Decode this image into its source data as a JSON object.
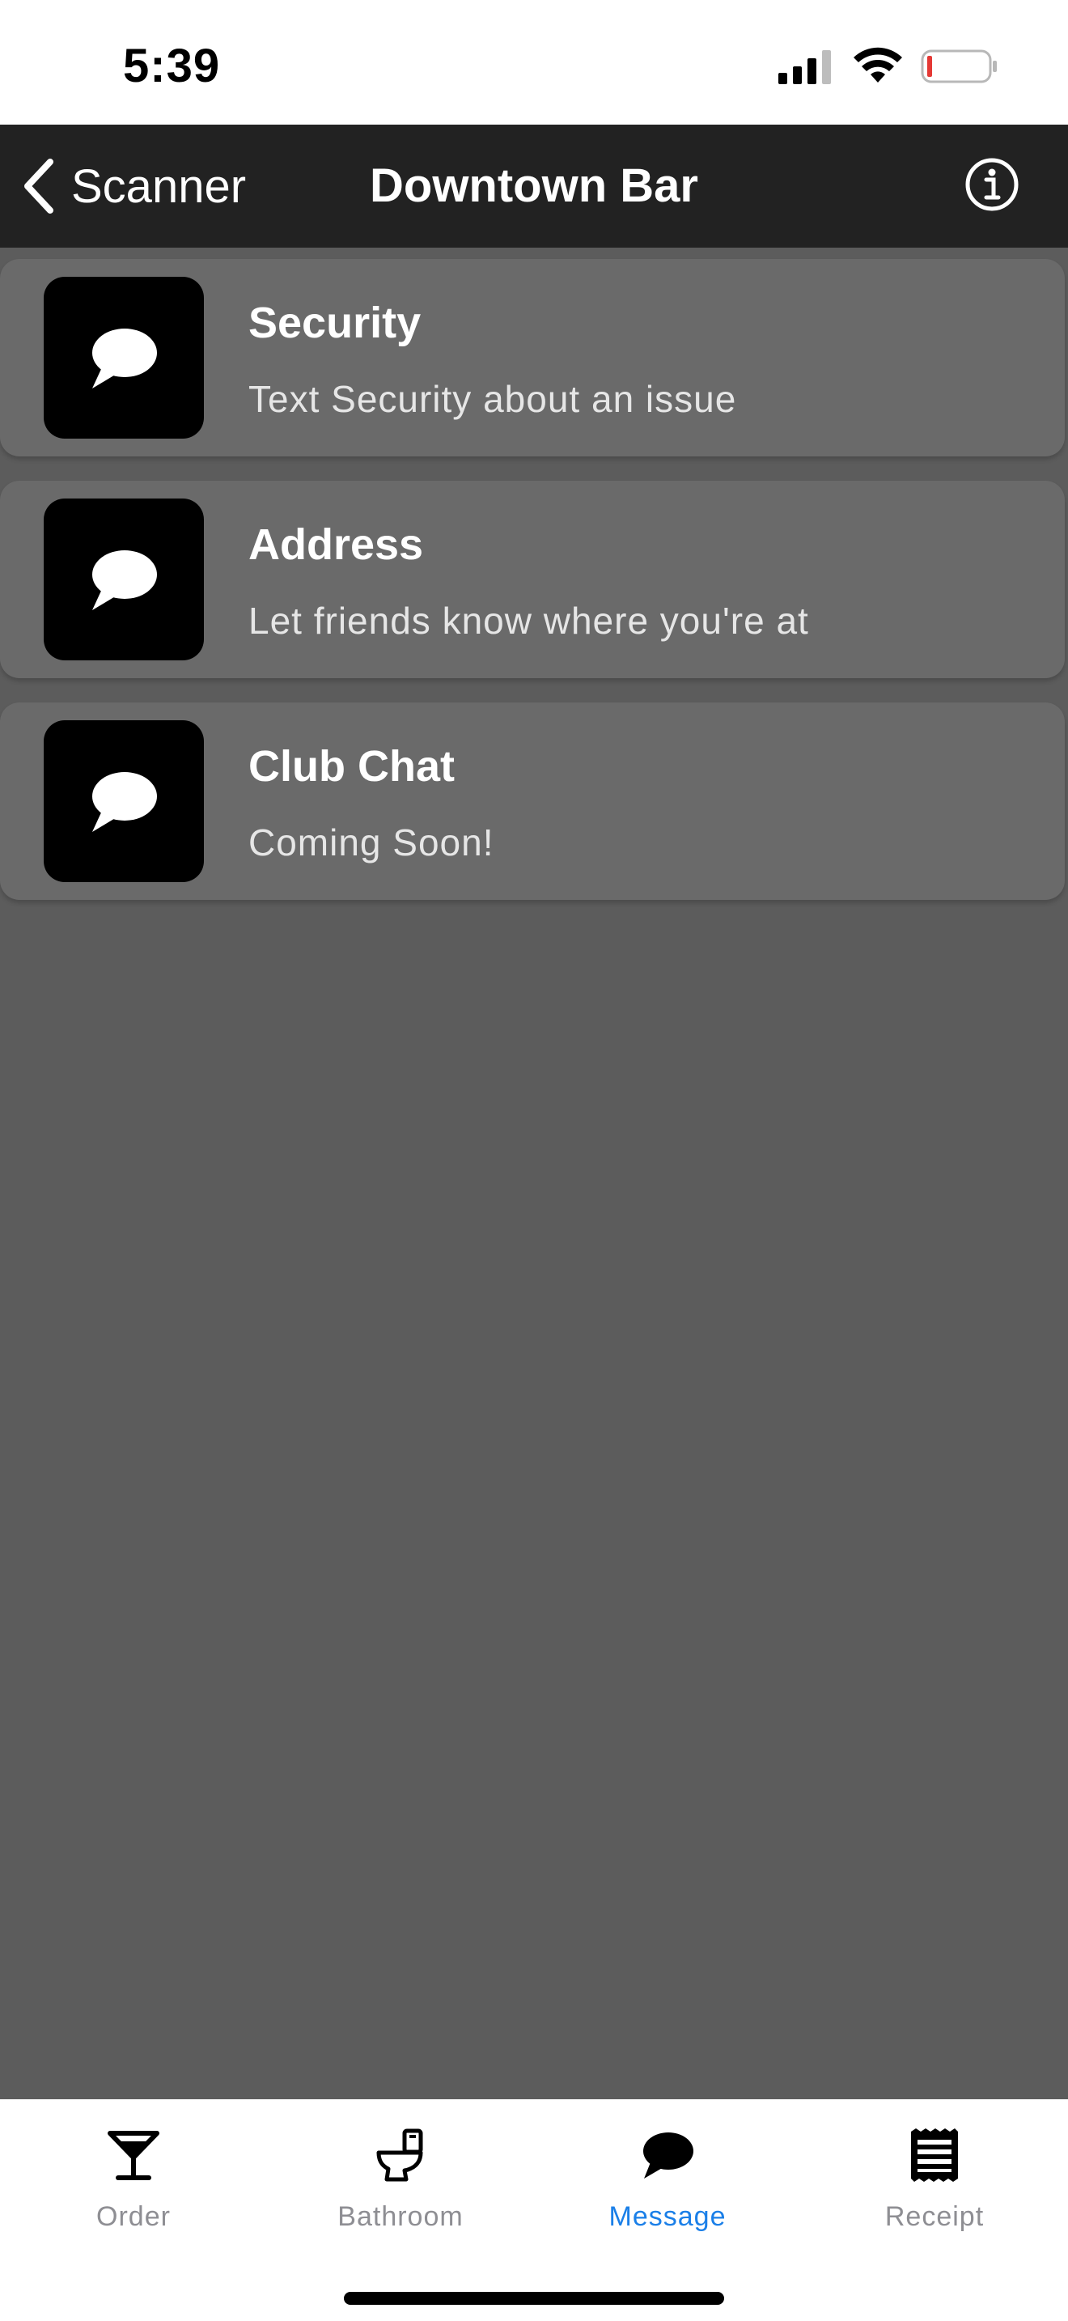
{
  "status_bar": {
    "time": "5:39",
    "icons": [
      "signal-icon",
      "wifi-icon",
      "battery-icon"
    ]
  },
  "nav": {
    "back_label": "Scanner",
    "title": "Downtown Bar",
    "back_icon": "chevron-left-icon",
    "info_icon": "info-icon"
  },
  "items": [
    {
      "title": "Security",
      "subtitle": "Text Security about an issue",
      "icon": "chat-bubble-icon"
    },
    {
      "title": "Address",
      "subtitle": "Let friends know where you're at",
      "icon": "chat-bubble-icon"
    },
    {
      "title": "Club Chat",
      "subtitle": "Coming Soon!",
      "icon": "chat-bubble-icon"
    }
  ],
  "tabs": [
    {
      "label": "Order",
      "icon": "cocktail-glass-icon",
      "active": false
    },
    {
      "label": "Bathroom",
      "icon": "toilet-icon",
      "active": false
    },
    {
      "label": "Message",
      "icon": "chat-bubble-icon",
      "active": true
    },
    {
      "label": "Receipt",
      "icon": "receipt-icon",
      "active": false
    }
  ],
  "colors": {
    "background": "#5c5c5c",
    "nav_bar": "#222222",
    "card": "#6a6a6a",
    "active_tab": "#1a7fe8",
    "inactive_tab": "#8e8e93",
    "battery_low": "#e53935"
  }
}
